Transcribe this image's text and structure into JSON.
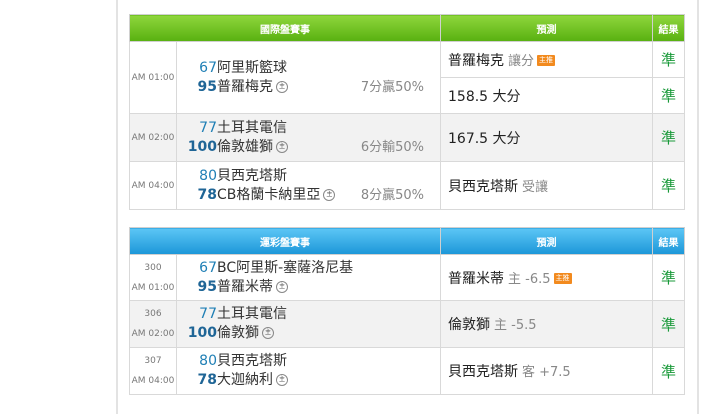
{
  "table1": {
    "header": {
      "match": "國際盤賽事",
      "prediction": "預測",
      "result": "結果"
    },
    "rows": [
      {
        "time": "AM 01:00",
        "score1": "67",
        "score2": "95",
        "team1": "阿里斯籃球",
        "team2": "普羅梅克",
        "host": "主",
        "margin": "7分贏50%",
        "predictions": [
          {
            "text": "普羅梅克",
            "sub": "讓分",
            "badge": "主推",
            "result": "準"
          },
          {
            "text": "158.5 大分",
            "sub": "",
            "badge": "",
            "result": "準"
          }
        ]
      },
      {
        "time": "AM 02:00",
        "score1": "77",
        "score2": "100",
        "team1": "土耳其電信",
        "team2": "倫敦雄獅",
        "host": "主",
        "margin": "6分輸50%",
        "predictions": [
          {
            "text": "167.5 大分",
            "sub": "",
            "badge": "",
            "result": "準"
          }
        ]
      },
      {
        "time": "AM 04:00",
        "score1": "80",
        "score2": "78",
        "team1": "貝西克塔斯",
        "team2": "CB格蘭卡納里亞",
        "host": "主",
        "margin": "8分贏50%",
        "predictions": [
          {
            "text": "貝西克塔斯",
            "sub": "受讓",
            "badge": "",
            "result": "準"
          }
        ]
      }
    ]
  },
  "table2": {
    "header": {
      "match": "運彩盤賽事",
      "prediction": "預測",
      "result": "結果"
    },
    "rows": [
      {
        "num": "300",
        "time": "AM 01:00",
        "score1": "67",
        "score2": "95",
        "team1": "BC阿里斯-塞薩洛尼基",
        "team2": "普羅米蒂",
        "host": "主",
        "pred": "普羅米蒂",
        "sub": "主 -6.5",
        "badge": "主推",
        "result": "準"
      },
      {
        "num": "306",
        "time": "AM 02:00",
        "score1": "77",
        "score2": "100",
        "team1": "土耳其電信",
        "team2": "倫敦獅",
        "host": "主",
        "pred": "倫敦獅",
        "sub": "主 -5.5",
        "badge": "",
        "result": "準"
      },
      {
        "num": "307",
        "time": "AM 04:00",
        "score1": "80",
        "score2": "78",
        "team1": "貝西克塔斯",
        "team2": "大迦納利",
        "host": "主",
        "pred": "貝西克塔斯",
        "sub": "客 +7.5",
        "badge": "",
        "result": "準"
      }
    ]
  }
}
